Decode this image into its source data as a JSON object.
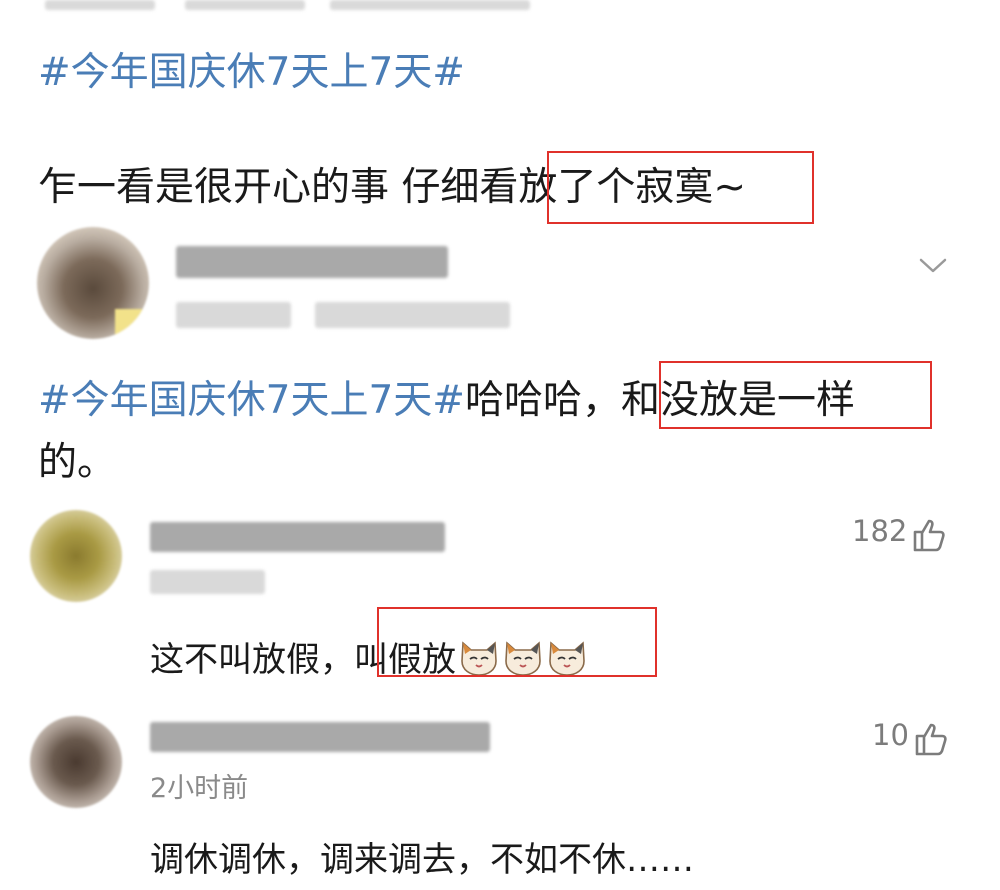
{
  "post1": {
    "hashtag": "#今年国庆休7天上7天#",
    "text_before_highlight": "乍一看是很开心的事 仔细看",
    "highlight": "放了个寂寞~"
  },
  "post2": {
    "hashtag": "#今年国庆休7天上7天#",
    "text_before_highlight": "哈哈哈，",
    "highlight": "和没放是一样",
    "text_after": "的。"
  },
  "reply1": {
    "likes": "182",
    "text_before_highlight": "这不叫放假，",
    "highlight": "叫假放",
    "emoji_icon": "cat-face-icon"
  },
  "reply2": {
    "likes": "10",
    "timestamp": "2小时前",
    "text": "调休调休，调来调去，不如不休……"
  },
  "colors": {
    "hashtag": "#4a7db6",
    "annotation_box": "#e0312b",
    "muted": "#8a8a8a"
  }
}
